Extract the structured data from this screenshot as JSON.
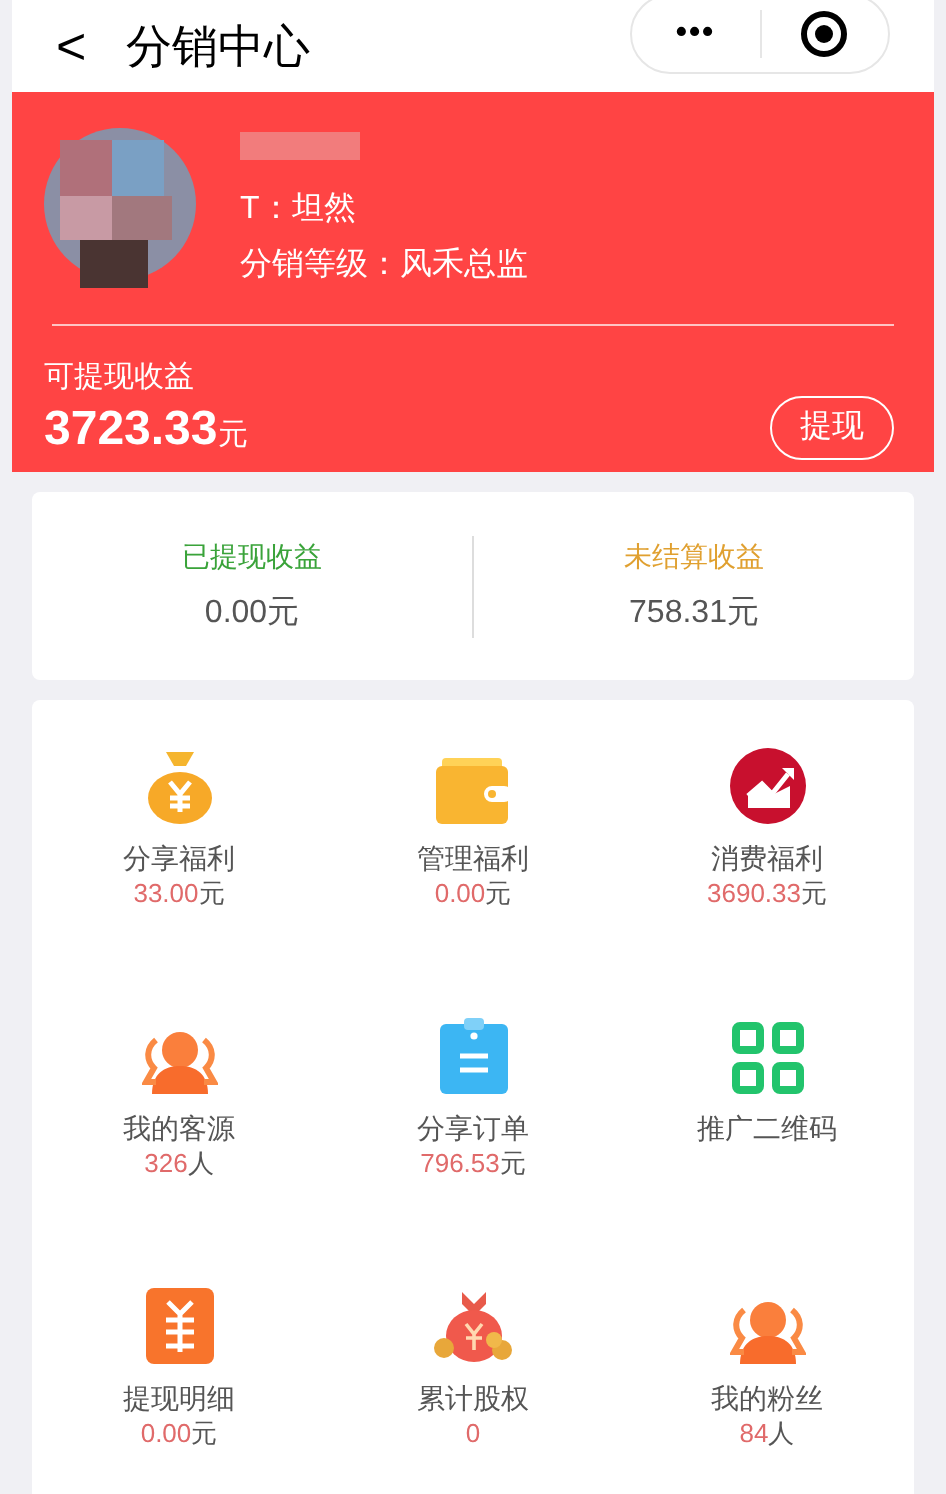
{
  "nav": {
    "back": "<",
    "title": "分销中心",
    "more": "•••"
  },
  "profile": {
    "team": "T：坦然",
    "level": "分销等级：风禾总监"
  },
  "balance": {
    "label": "可提现收益",
    "amount": "3723.33",
    "unit": "元",
    "button": "提现"
  },
  "stats": [
    {
      "label": "已提现收益",
      "value": "0.00元",
      "color": "#3aa33a"
    },
    {
      "label": "未结算收益",
      "value": "758.31元",
      "color": "#e0a030"
    }
  ],
  "grid": [
    {
      "label": "分享福利",
      "value": "33.00",
      "unit": "元"
    },
    {
      "label": "管理福利",
      "value": "0.00",
      "unit": "元"
    },
    {
      "label": "消费福利",
      "value": "3690.33",
      "unit": "元"
    },
    {
      "label": "我的客源",
      "value": "326",
      "unit": "人"
    },
    {
      "label": "分享订单",
      "value": "796.53",
      "unit": "元"
    },
    {
      "label": "推广二维码"
    },
    {
      "label": "提现明细",
      "value": "0.00",
      "unit": "元"
    },
    {
      "label": "累计股权",
      "value": "0"
    },
    {
      "label": "我的粉丝",
      "value": "84",
      "unit": "人"
    }
  ]
}
